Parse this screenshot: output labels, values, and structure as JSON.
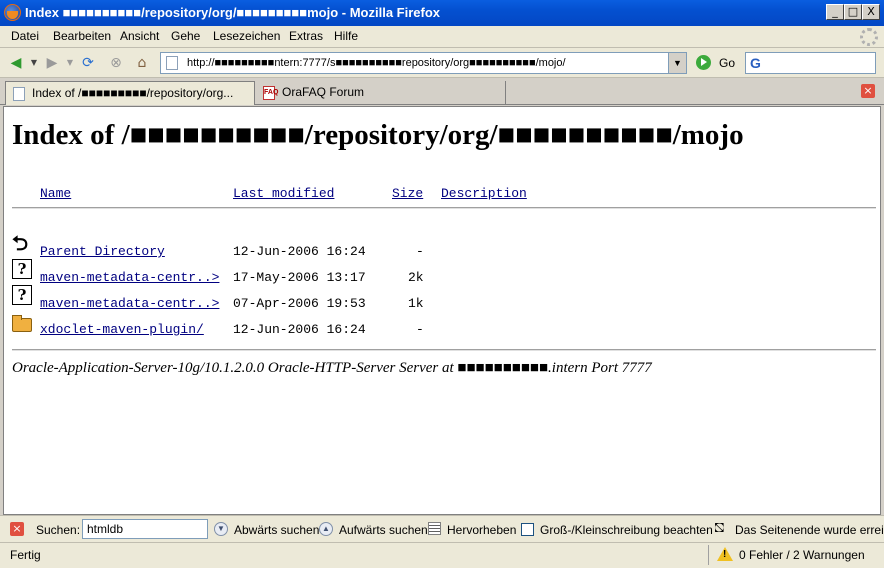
{
  "window": {
    "title": "Index ■■■■■■■■■■/repository/org/■■■■■■■■■mojo - Mozilla Firefox",
    "buttons": {
      "minimize": "_",
      "maximize": "□",
      "close": "X"
    }
  },
  "menu": {
    "items": [
      {
        "label": "Datei"
      },
      {
        "label": "Bearbeiten"
      },
      {
        "label": "Ansicht"
      },
      {
        "label": "Gehe"
      },
      {
        "label": "Lesezeichen"
      },
      {
        "label": "Extras"
      },
      {
        "label": "Hilfe"
      }
    ]
  },
  "nav": {
    "url": "http://■■■■■■■■■ntern:7777/s■■■■■■■■■■repository/org■■■■■■■■■■/mojo/",
    "go_label": "Go",
    "search_value": ""
  },
  "tabs": [
    {
      "label": "Index of /■■■■■■■■■/repository/org...",
      "active": true
    },
    {
      "label": "OraFAQ Forum",
      "active": false
    }
  ],
  "page": {
    "heading": "Index of /■■■■■■■■■■/repository/org/■■■■■■■■■■/mojo",
    "columns": {
      "name": "Name",
      "modified": "Last modified",
      "size": "Size",
      "description": "Description"
    },
    "rows": [
      {
        "icon": "back-icon",
        "name": "Parent Directory",
        "modified": "12-Jun-2006 16:24",
        "size": "-"
      },
      {
        "icon": "unknown-file-icon",
        "name": "maven-metadata-centr..>",
        "modified": "17-May-2006 13:17",
        "size": "2k"
      },
      {
        "icon": "unknown-file-icon",
        "name": "maven-metadata-centr..>",
        "modified": "07-Apr-2006 19:53",
        "size": "1k"
      },
      {
        "icon": "folder-icon",
        "name": "xdoclet-maven-plugin/",
        "modified": "12-Jun-2006 16:24",
        "size": "-"
      }
    ],
    "address": "Oracle-Application-Server-10g/10.1.2.0.0 Oracle-HTTP-Server Server at ■■■■■■■■■■.intern Port 7777"
  },
  "findbar": {
    "label": "Suchen:",
    "value": "htmldb",
    "down_label": "Abwärts suchen",
    "up_label": "Aufwärts suchen",
    "highlight_label": "Hervorheben",
    "case_label": "Groß-/Kleinschreibung beachten",
    "wrap_message": "Das Seitenende wurde erreicht"
  },
  "status": {
    "text": "Fertig",
    "warnings": "0 Fehler / 2 Warnungen"
  },
  "colors": {
    "titlebar": "#0450d0",
    "link": "#000080",
    "redaction": "#ff7a3a"
  }
}
